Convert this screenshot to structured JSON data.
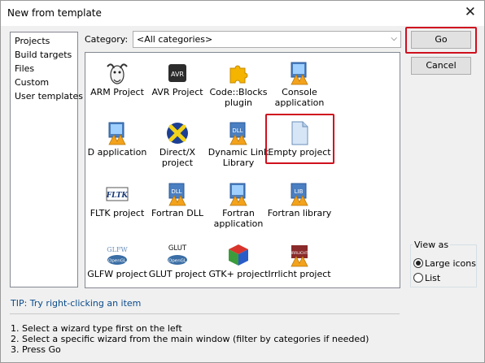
{
  "window": {
    "title": "New from template",
    "close_glyph": "✕"
  },
  "sidebar": {
    "items": [
      {
        "label": "Projects",
        "selected": true
      },
      {
        "label": "Build targets"
      },
      {
        "label": "Files"
      },
      {
        "label": "Custom"
      },
      {
        "label": "User templates"
      }
    ]
  },
  "category": {
    "label": "Category:",
    "value": "<All categories>"
  },
  "templates": [
    {
      "label": "ARM Project",
      "icon": "gnu-head-icon"
    },
    {
      "label": "AVR Project",
      "icon": "avr-chip-icon"
    },
    {
      "label": "Code::Blocks plugin",
      "icon": "puzzle-piece-icon"
    },
    {
      "label": "Console application",
      "icon": "console-app-icon"
    },
    {
      "label": "D application",
      "icon": "d-app-icon"
    },
    {
      "label": "Direct/X project",
      "icon": "directx-icon"
    },
    {
      "label": "Dynamic Link Library",
      "icon": "dll-icon"
    },
    {
      "label": "Empty project",
      "icon": "blank-page-icon"
    },
    {
      "label": "FLTK project",
      "icon": "fltk-icon"
    },
    {
      "label": "Fortran DLL",
      "icon": "fortran-dll-icon"
    },
    {
      "label": "Fortran application",
      "icon": "fortran-app-icon"
    },
    {
      "label": "Fortran library",
      "icon": "fortran-lib-icon"
    },
    {
      "label": "GLFW project",
      "icon": "glfw-icon"
    },
    {
      "label": "GLUT project",
      "icon": "glut-icon"
    },
    {
      "label": "GTK+ project",
      "icon": "gtk-cube-icon"
    },
    {
      "label": "Irrlicht project",
      "icon": "irrlicht-icon"
    }
  ],
  "icon_text": {
    "avr": "AVR",
    "dll": "DLL",
    "fltk": "FLTK",
    "lib": "LIB",
    "glfw": "GLFW",
    "glut": "GLUT",
    "opengl": "OpenGL",
    "irrlicht": "IRRLICHT"
  },
  "buttons": {
    "go": "Go",
    "cancel": "Cancel"
  },
  "view_as": {
    "title": "View as",
    "options": [
      {
        "label": "Large icons",
        "checked": true
      },
      {
        "label": "List",
        "checked": false
      }
    ]
  },
  "tip": "TIP: Try right-clicking an item",
  "steps": [
    "1. Select a wizard type first on the left",
    "2. Select a specific wizard from the main window (filter by categories if needed)",
    "3. Press Go"
  ],
  "colors": {
    "highlight": "#d0101e",
    "tip_text": "#0a4a8a"
  }
}
